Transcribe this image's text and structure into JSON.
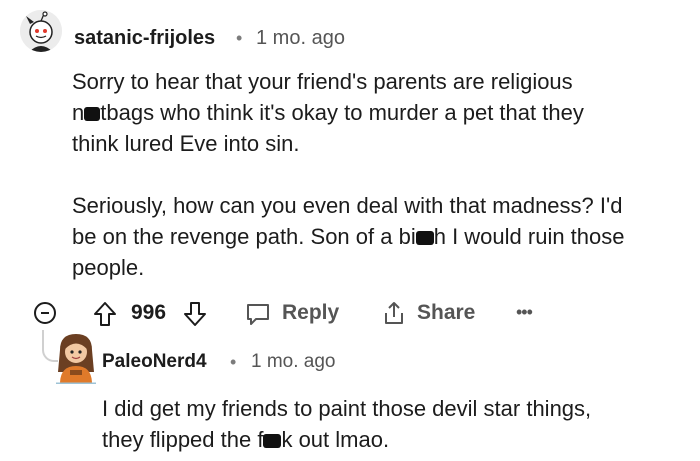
{
  "comment": {
    "username": "satanic-frijoles",
    "separator": "•",
    "timestamp": "1 mo. ago",
    "body": {
      "line1": "Sorry to hear that your friend's parents are religious",
      "line2_pre": "n",
      "line2_post": "tbags who think it's okay to murder a pet that they",
      "line3": "think lured Eve into sin.",
      "line4": "Seriously, how can you even deal with that madness? I'd",
      "line5_pre": "be on the revenge path. Son of a bi",
      "line5_post": "h I would ruin those",
      "line6": "people."
    },
    "actions": {
      "vote_count": "996",
      "reply_label": "Reply",
      "share_label": "Share",
      "more_label": "•••"
    }
  },
  "reply": {
    "username": "PaleoNerd4",
    "separator": "•",
    "timestamp": "1 mo. ago",
    "body": {
      "line1": "I did get my friends to paint those devil star things,",
      "line2_pre": "they flipped the f",
      "line2_post": "k out lmao."
    }
  },
  "colors": {
    "text": "#1c1c1c",
    "muted": "#555555",
    "thread_line": "#d0d0d0",
    "avatar_shirt": "#e07a2a"
  }
}
